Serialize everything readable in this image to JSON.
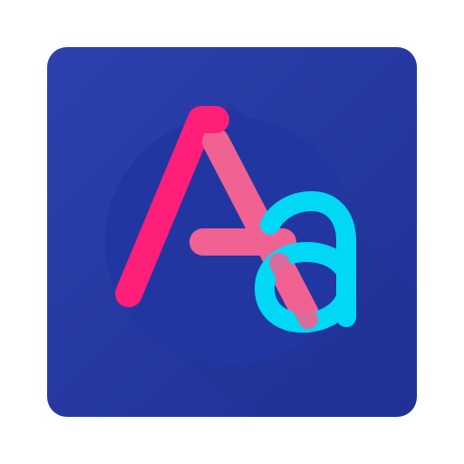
{
  "icon": {
    "name": "font-app-icon",
    "glyphs": {
      "uppercase": "A",
      "lowercase": "a"
    },
    "colors": {
      "tile": "#2A3DA8",
      "tile_dark": "#1E2F93",
      "circle": "#2236A0",
      "shadow": "#16247A",
      "letter_a_upper_pink": "#FF1E78",
      "letter_a_upper_light_pink": "#F06292",
      "letter_a_lower_cyan": "#00D8F5"
    }
  }
}
